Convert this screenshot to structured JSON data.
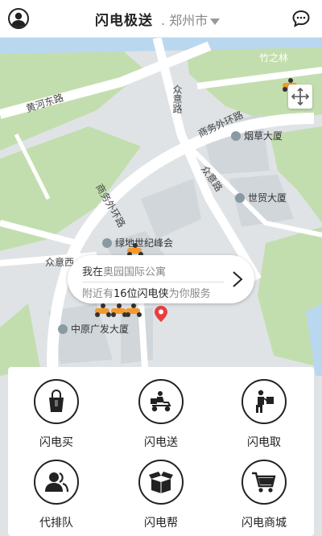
{
  "header": {
    "title": "闪电极送",
    "city": ". 郑州市"
  },
  "map": {
    "roads": [
      "黄河东路",
      "众意路",
      "商务外环路",
      "商务外环路",
      "众意路",
      "众意西"
    ],
    "pois": [
      "烟草大厦",
      "世贸大厦",
      "绿地世纪峰会",
      "中原广发大厦"
    ],
    "partial_label": "竹之林"
  },
  "location_card": {
    "prefix": "我在",
    "place": "奥园国际公寓",
    "nearby_prefix": "附近有",
    "count": "16位闪电侠",
    "nearby_suffix": "为你服务"
  },
  "services": [
    {
      "label": "闪电买",
      "icon": "shopping-bag-icon"
    },
    {
      "label": "闪电送",
      "icon": "delivery-scooter-icon"
    },
    {
      "label": "闪电取",
      "icon": "pickup-person-icon"
    },
    {
      "label": "代排队",
      "icon": "queue-people-icon"
    },
    {
      "label": "闪电帮",
      "icon": "open-box-icon"
    },
    {
      "label": "闪电商城",
      "icon": "shopping-cart-icon"
    }
  ],
  "colors": {
    "green_area": "#c3deae",
    "map_bg": "#dfe3e6",
    "road": "#ffffff",
    "marker": "#e8403e",
    "scooter": "#f29a2e"
  }
}
